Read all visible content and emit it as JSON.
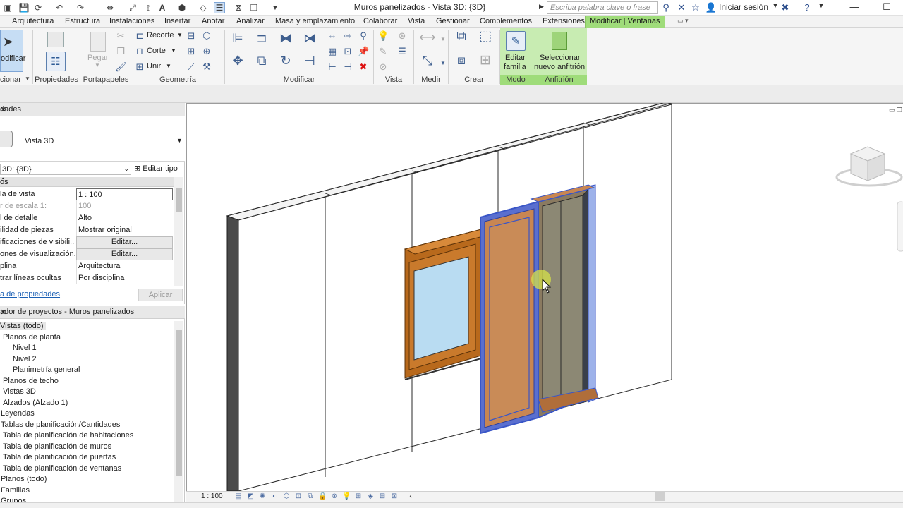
{
  "window": {
    "title": "Muros panelizados - Vista 3D: {3D}",
    "search_placeholder": "Escriba palabra clave o frase",
    "signin_label": "Iniciar sesión"
  },
  "ribbon_tabs": [
    "Arquitectura",
    "Estructura",
    "Instalaciones",
    "Insertar",
    "Anotar",
    "Analizar",
    "Masa y emplazamiento",
    "Colaborar",
    "Vista",
    "Gestionar",
    "Complementos",
    "Extensiones"
  ],
  "active_tab": "Modificar | Ventanas",
  "ribbon": {
    "modify_label": "odificar",
    "select_panel": "cionar",
    "panels": {
      "propiedades": "Propiedades",
      "portapapeles": "Portapapeles",
      "geometria": "Geometría",
      "modificar": "Modificar",
      "vista": "Vista",
      "medir": "Medir",
      "crear": "Crear",
      "modo": "Modo",
      "anfitrion": "Anfitrión"
    },
    "clipboard_paste": "Pegar",
    "geometry": {
      "cope": "Recorte",
      "cut": "Corte",
      "join": "Unir"
    },
    "edit_family": [
      "Editar",
      "familia"
    ],
    "pick_new_host": [
      "Seleccionar",
      "nuevo anfitrión"
    ]
  },
  "properties": {
    "header": "dades",
    "type_name": "Vista 3D",
    "view_selector": "3D: {3D}",
    "edit_type": "Editar tipo",
    "group": "os",
    "rows": [
      {
        "key": "la de vista",
        "value": "1 : 100"
      },
      {
        "key": "r de escala    1:",
        "value": "100"
      },
      {
        "key": "l de detalle",
        "value": "Alto"
      },
      {
        "key": "ilidad de piezas",
        "value": "Mostrar original"
      },
      {
        "key": "ificaciones de visibili...",
        "value": "Editar..."
      },
      {
        "key": "ones de visualización...",
        "value": "Editar..."
      },
      {
        "key": "plina",
        "value": "Arquitectura"
      },
      {
        "key": "trar líneas ocultas",
        "value": "Por disciplina"
      }
    ],
    "help_link": "a de propiedades",
    "apply": "Aplicar"
  },
  "browser": {
    "header": "ador de proyectos - Muros panelizados",
    "items": [
      "Vistas (todo)",
      "Planos de planta",
      "Nivel 1",
      "Nivel 2",
      "Planimetría general",
      "Planos de techo",
      "Vistas 3D",
      "Alzados (Alzado 1)",
      "Leyendas",
      "Tablas de planificación/Cantidades",
      "Tabla de planificación de habitaciones",
      "Tabla de planificación de muros",
      "Tabla de planificación de puertas",
      "Tabla de planificación de ventanas",
      "Planos (todo)",
      "Familias",
      "Grupos"
    ]
  },
  "viewbar": {
    "scale": "1 : 100"
  },
  "colors": {
    "active_tab": "#9fdc7a",
    "context_panel": "#c8ecb2",
    "selection_blue": "#3a56c7",
    "wood": "#b8691c",
    "glass": "#b9dcf2"
  }
}
